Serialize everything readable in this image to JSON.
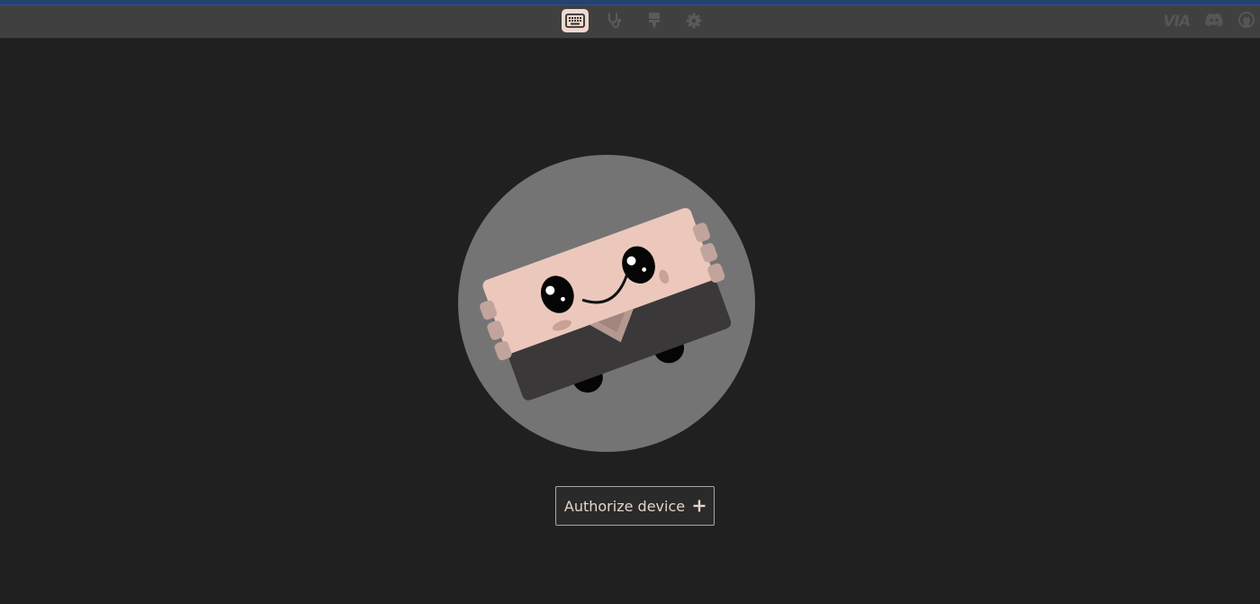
{
  "window": {
    "accent_color": "#25426e"
  },
  "topbar": {
    "background": "#404040",
    "nav": [
      {
        "id": "configure",
        "icon": "keyboard-icon",
        "active": true
      },
      {
        "id": "test",
        "icon": "stethoscope-icon",
        "active": false
      },
      {
        "id": "design",
        "icon": "design-icon",
        "active": false
      },
      {
        "id": "settings",
        "icon": "gear-icon",
        "active": false
      }
    ],
    "brand": "VIA",
    "links": [
      {
        "id": "discord",
        "icon": "discord-icon"
      },
      {
        "id": "github",
        "icon": "github-icon"
      }
    ]
  },
  "hero": {
    "icon": "keyboard-mascot-icon"
  },
  "actions": {
    "authorize_label": "Authorize device",
    "authorize_icon": "plus-icon"
  },
  "colors": {
    "accent_active": "#f1d8cf",
    "button_text": "#e5d3cc",
    "background": "#202020"
  }
}
